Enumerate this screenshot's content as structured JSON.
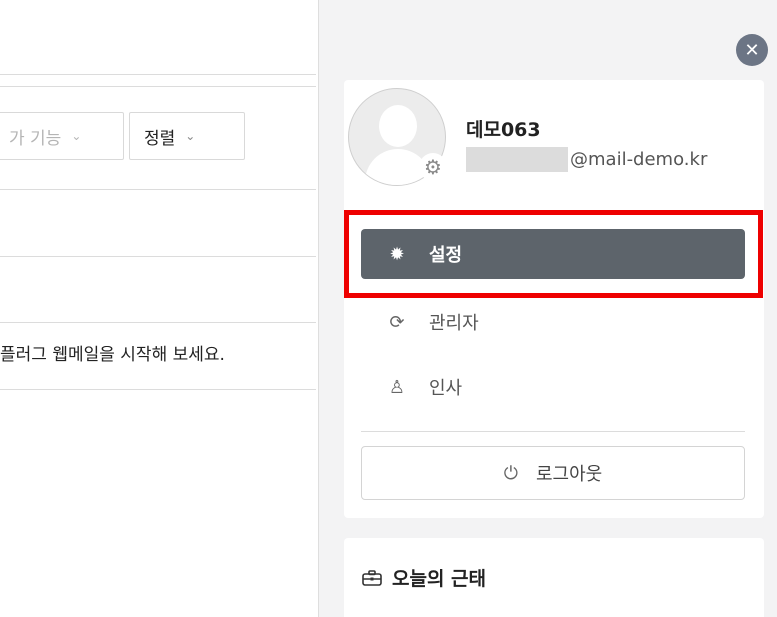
{
  "left": {
    "toolbar": {
      "more_label": "가 기능",
      "sort_label": "정렬"
    },
    "intro_text": "플러그 웹메일을 시작해 보세요."
  },
  "drawer": {
    "close_icon": "✕",
    "profile": {
      "username": "데모063",
      "email_domain": "@mail-demo.kr"
    },
    "menu": [
      {
        "label": "설정",
        "icon": "gear-icon",
        "glyph": "✹"
      },
      {
        "label": "관리자",
        "icon": "refresh-icon",
        "glyph": "⟳"
      },
      {
        "label": "인사",
        "icon": "org-chart-icon",
        "glyph": "♙"
      }
    ],
    "logout_label": "로그아웃",
    "attendance_title": "오늘의 근태"
  },
  "colors": {
    "active_menu_bg": "#5d646b",
    "highlight_border": "#ee0000",
    "close_button_bg": "#6c7585",
    "drawer_bg": "#f3f3f4"
  }
}
